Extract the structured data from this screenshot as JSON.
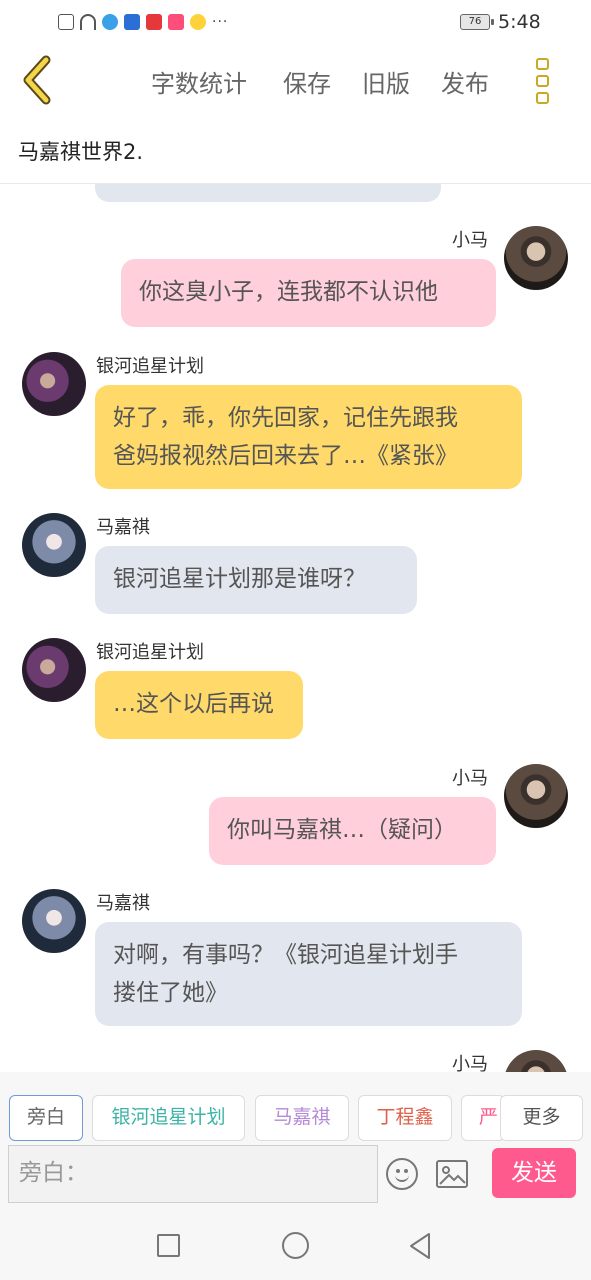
{
  "status_bar": {
    "battery": "76",
    "time": "5:48",
    "more": "···"
  },
  "toolbar": {
    "word_count": "字数统计",
    "save": "保存",
    "old_version": "旧版",
    "publish": "发布"
  },
  "story_title": "马嘉祺世界2.",
  "messages": [
    {
      "side": "right",
      "sender": "小马",
      "text": "你这臭小子，连我都不认识他",
      "color": "pink"
    },
    {
      "side": "left",
      "sender": "银河追星计划",
      "text": "好了，乖，你先回家，记住先跟我爸妈报视然后回来去了…《紧张》",
      "line1": "好了，乖，你先回家，记住先跟我",
      "line2": "爸妈报视然后回来去了…《紧张》",
      "color": "yellow"
    },
    {
      "side": "left",
      "sender": "马嘉祺",
      "text": "银河追星计划那是谁呀？",
      "color": "gray"
    },
    {
      "side": "left",
      "sender": "银河追星计划",
      "text": "…这个以后再说",
      "color": "yellow"
    },
    {
      "side": "right",
      "sender": "小马",
      "text": "你叫马嘉祺…（疑问）",
      "color": "pink"
    },
    {
      "side": "left",
      "sender": "马嘉祺",
      "text": "对啊，有事吗？《银河追星计划手搂住了她》",
      "line1": "对啊，有事吗？《银河追星计划手",
      "line2": "搂住了她》",
      "color": "gray"
    },
    {
      "side": "right",
      "sender": "小马",
      "text": "",
      "color": "pink"
    }
  ],
  "roles": [
    {
      "label": "旁白",
      "color": "#666666"
    },
    {
      "label": "银河追星计划",
      "color": "#3bb3a6"
    },
    {
      "label": "马嘉祺",
      "color": "#b48ad8"
    },
    {
      "label": "丁程鑫",
      "color": "#e0604a"
    },
    {
      "label": "严",
      "color": "#ff5a8e"
    }
  ],
  "more_roles": "更多",
  "input": {
    "placeholder": "旁白："
  },
  "send_label": "发送",
  "colors": {
    "accent": "#ff5a8e",
    "pink_bubble": "#ffcfdc",
    "yellow_bubble": "#ffda6a",
    "gray_bubble": "#e2e7ef",
    "back_icon": "#c9a823"
  }
}
